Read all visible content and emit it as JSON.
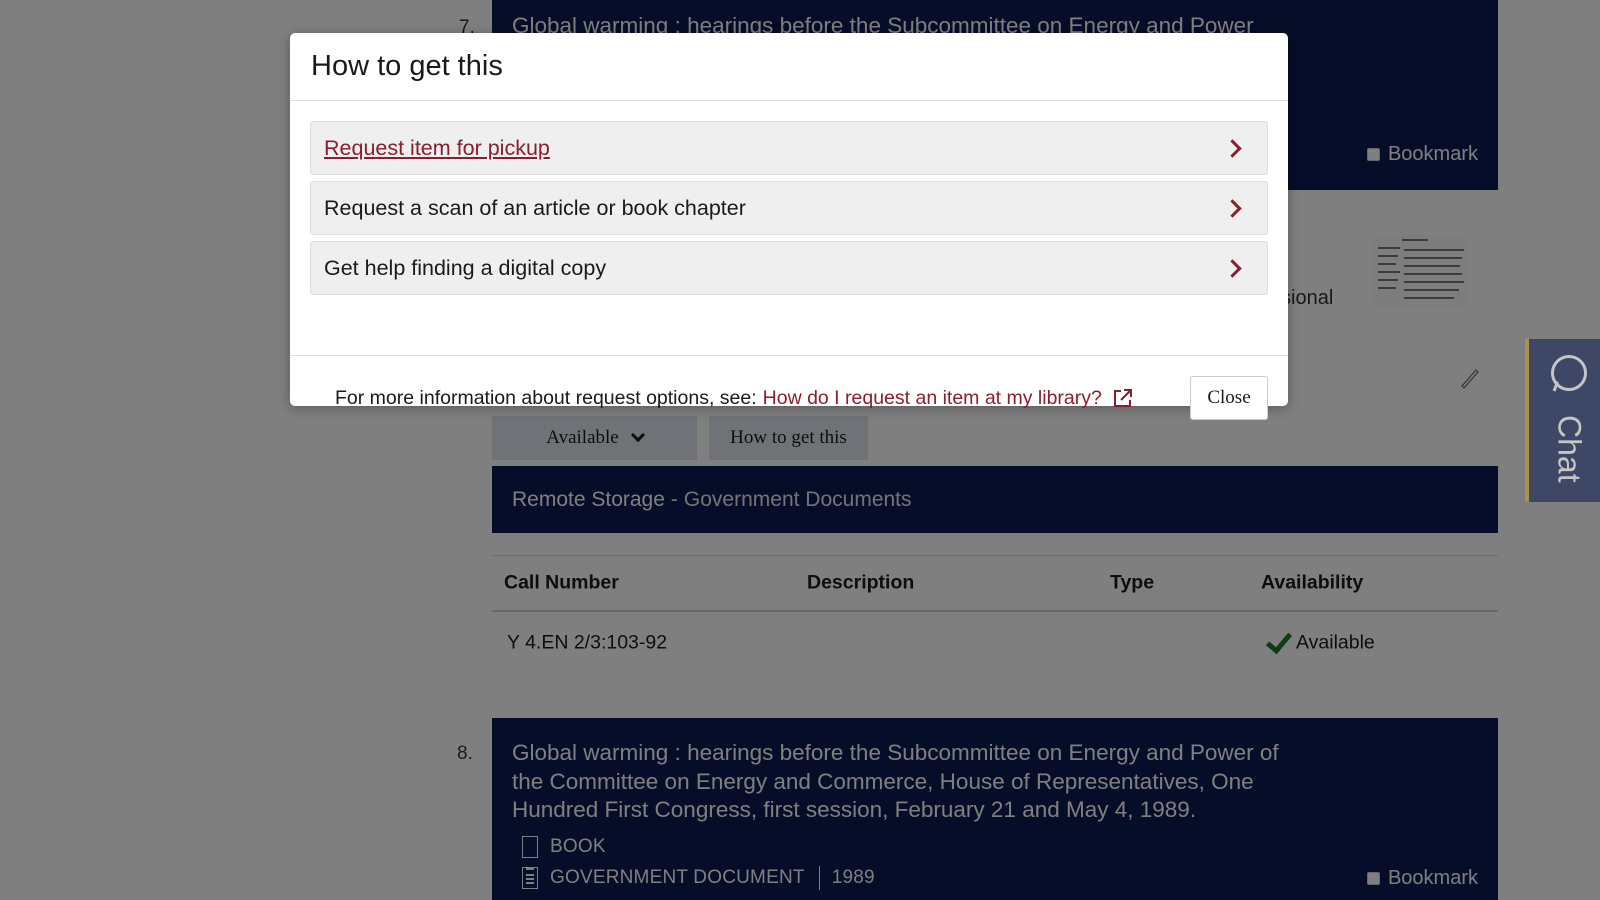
{
  "results": [
    {
      "number": "7.",
      "title": "Global warming : hearings before the Subcommittee on Energy and Power",
      "bookmark_label": "Bookmark",
      "snippet_partial": "ssional",
      "status_button": "Available",
      "how_button": "How to get this",
      "location": {
        "name": "Remote Storage",
        "separator": "-",
        "sublocation": "Government Documents"
      },
      "holdings": {
        "headers": [
          "Call Number",
          "Description",
          "Type",
          "Availability"
        ],
        "rows": [
          {
            "call_number": "Y 4.EN 2/3:103-92",
            "description": "",
            "type": "",
            "availability": "Available"
          }
        ]
      }
    },
    {
      "number": "8.",
      "title": "Global warming : hearings before the Subcommittee on Energy and Power of the Committee on Energy and Commerce, House of Representatives, One Hundred First Congress, first session, February 21 and May 4, 1989.",
      "formats": [
        "BOOK",
        "GOVERNMENT DOCUMENT"
      ],
      "year": "1989",
      "bookmark_label": "Bookmark"
    }
  ],
  "chat": {
    "label": "Chat",
    "icon": "chat-bubble-icon"
  },
  "modal": {
    "title": "How to get this",
    "options": [
      {
        "label": "Request item for pickup",
        "active": true
      },
      {
        "label": "Request a scan of an article or book chapter",
        "active": false
      },
      {
        "label": "Get help finding a digital copy",
        "active": false
      }
    ],
    "footer_text": "For more information about request options, see:",
    "footer_link": "How do I request an item at my library?",
    "close_label": "Close"
  },
  "colors": {
    "navy": "#0c1b52",
    "crimson": "#8b1e2e",
    "available_green": "#1e7a1e"
  }
}
